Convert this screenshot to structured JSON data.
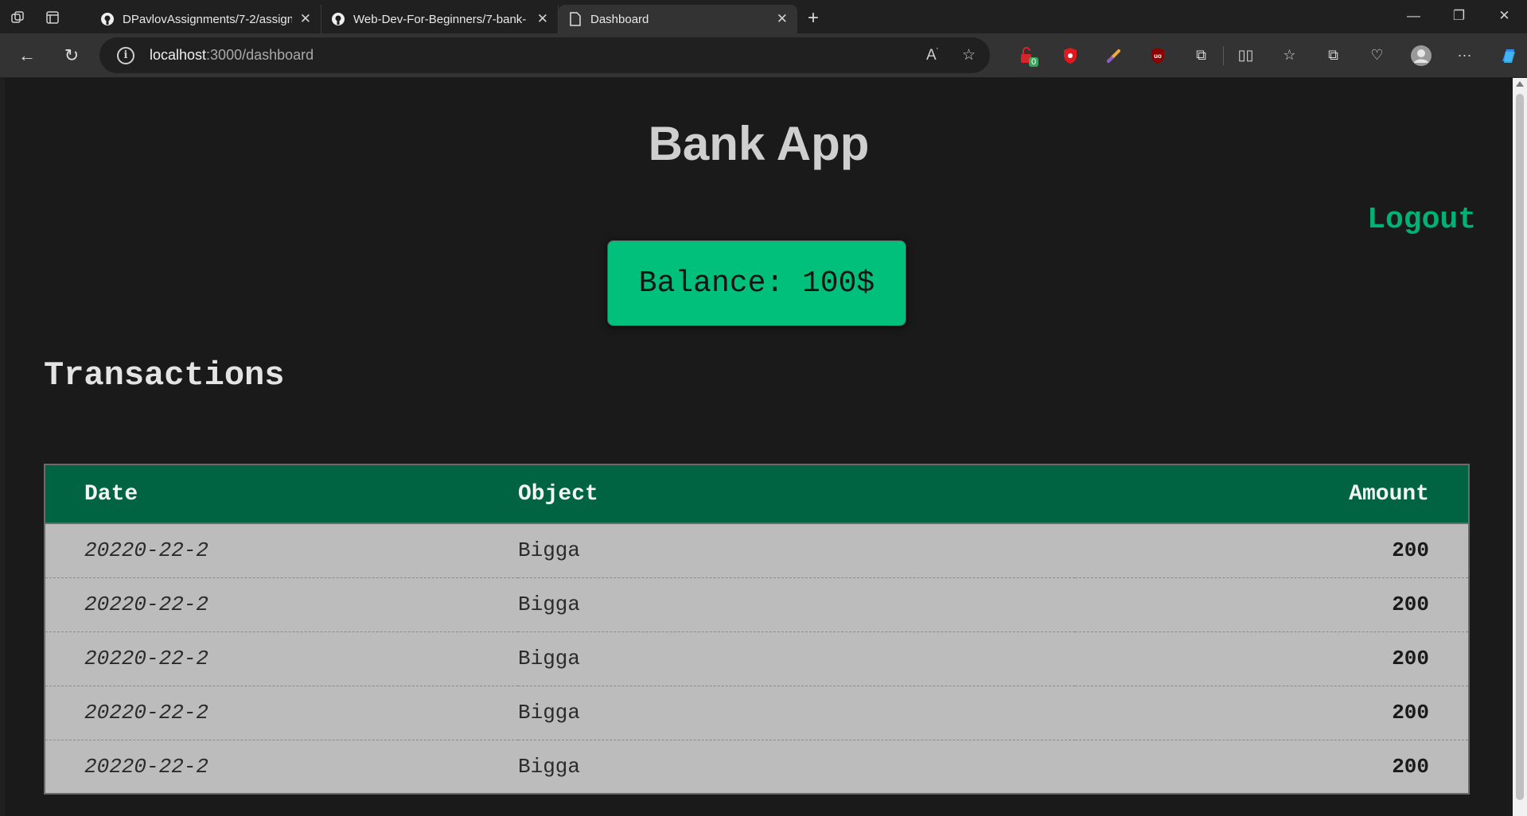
{
  "browser": {
    "tabs": [
      {
        "title": "DPavlovAssignments/7-2/assignm",
        "icon": "github-icon",
        "active": false
      },
      {
        "title": "Web-Dev-For-Beginners/7-bank-",
        "icon": "github-icon",
        "active": false
      },
      {
        "title": "Dashboard",
        "icon": "page-icon",
        "active": true
      }
    ],
    "url_host": "localhost",
    "url_path": ":3000/dashboard",
    "extension_badge": "0"
  },
  "page": {
    "app_title": "Bank App",
    "logout_label": "Logout",
    "balance_text": "Balance: 100$",
    "transactions_title": "Transactions",
    "table": {
      "headers": [
        "Date",
        "Object",
        "Amount"
      ],
      "rows": [
        [
          "20220-22-2",
          "Bigga",
          "200"
        ],
        [
          "20220-22-2",
          "Bigga",
          "200"
        ],
        [
          "20220-22-2",
          "Bigga",
          "200"
        ],
        [
          "20220-22-2",
          "Bigga",
          "200"
        ],
        [
          "20220-22-2",
          "Bigga",
          "200"
        ]
      ]
    }
  },
  "colors": {
    "accent": "#00c07b",
    "header": "#006341",
    "background": "#1a1a1a",
    "row": "#bcbcbc"
  }
}
